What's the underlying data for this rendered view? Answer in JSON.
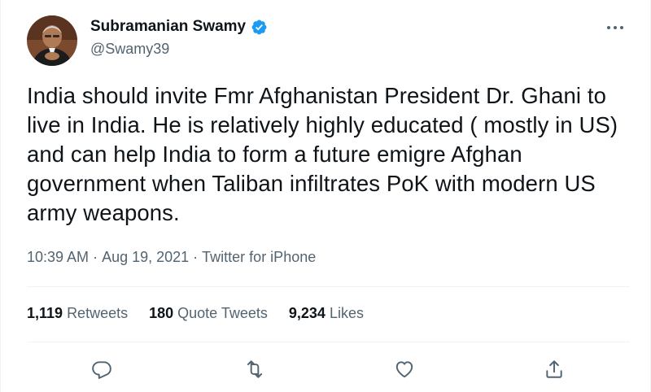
{
  "tweet": {
    "author": {
      "display_name": "Subramanian Swamy",
      "handle": "@Swamy39",
      "verified": true
    },
    "text": "India should invite Fmr Afghanistan President Dr. Ghani to live in India. He is relatively highly educated ( mostly in US) and can help India to form a future emigre Afghan government when Taliban infiltrates PoK with modern US army weapons.",
    "time": "10:39 AM",
    "separator": "·",
    "date": "Aug 19, 2021",
    "source": "Twitter for iPhone",
    "stats": {
      "retweets_count": "1,119",
      "retweets_label": "Retweets",
      "quotes_count": "180",
      "quotes_label": "Quote Tweets",
      "likes_count": "9,234",
      "likes_label": "Likes"
    }
  },
  "icons": {
    "more": "more-horizontal-icon",
    "verified": "verified-badge-icon",
    "reply": "reply-icon",
    "retweet": "retweet-icon",
    "like": "heart-icon",
    "share": "share-icon"
  },
  "colors": {
    "verified_blue": "#1d9bf0",
    "text_primary": "#0f1419",
    "text_secondary": "#536471",
    "divider": "#eff3f4"
  }
}
